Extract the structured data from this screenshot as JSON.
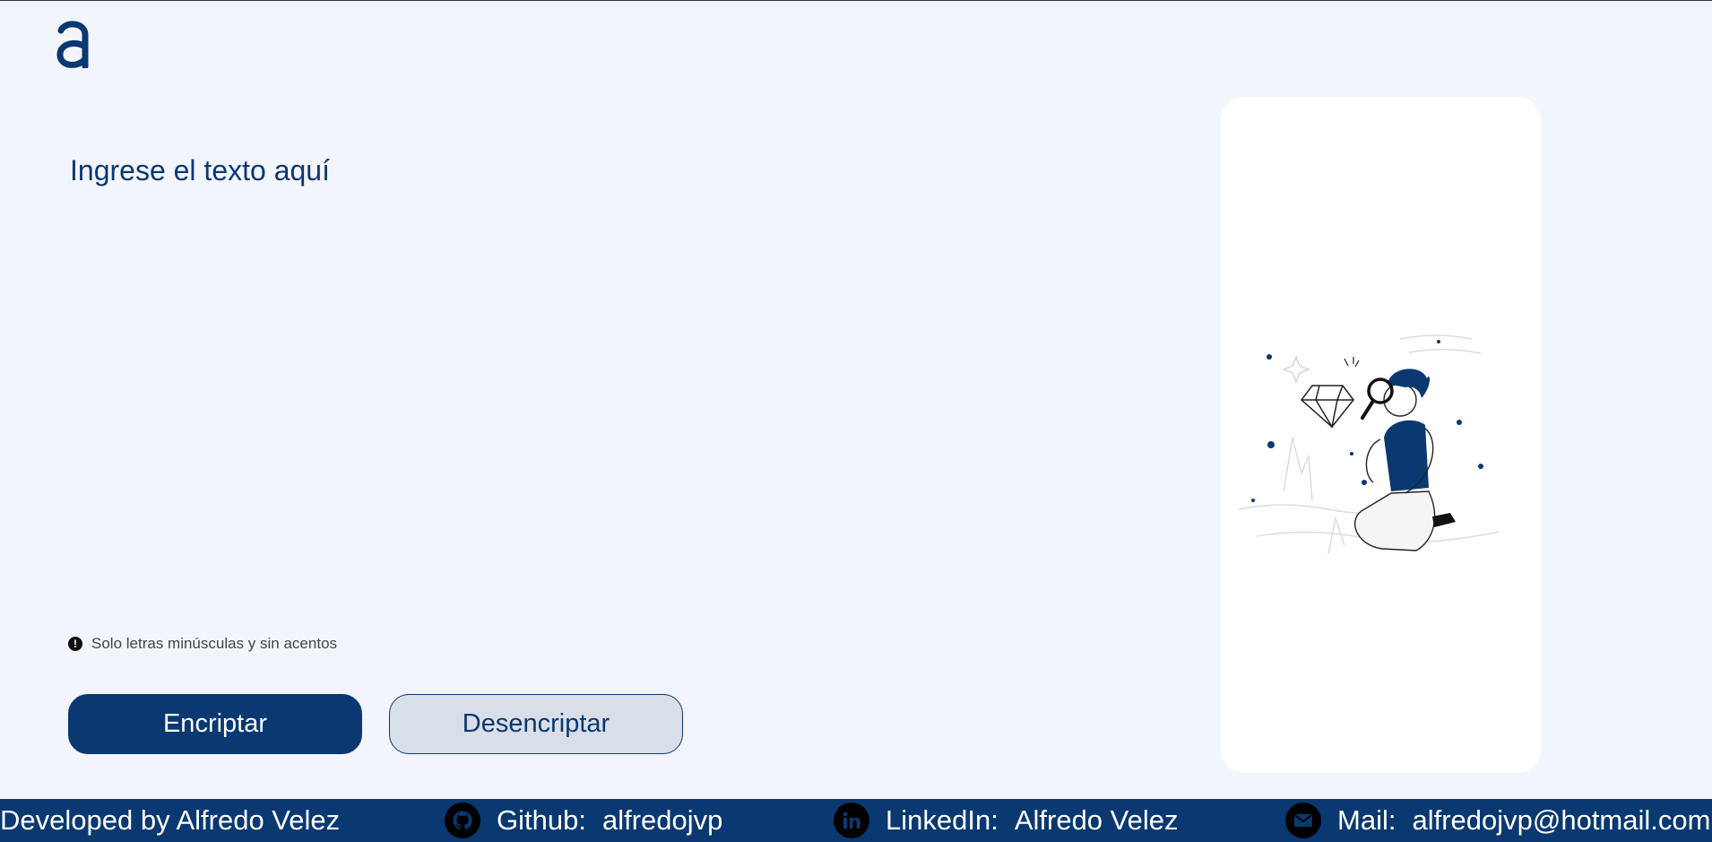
{
  "colors": {
    "accent": "#0a3871",
    "background": "#f3f5fc",
    "card": "#ffffff",
    "secondary_button": "#d8dfe8"
  },
  "logo": {
    "icon": "brand-a-logo"
  },
  "input": {
    "placeholder": "Ingrese el texto aquí",
    "value": ""
  },
  "hint": {
    "icon": "exclamation-circle-icon",
    "text": "Solo letras minúsculas y sin acentos"
  },
  "buttons": {
    "encrypt": "Encriptar",
    "decrypt": "Desencriptar"
  },
  "illustration": {
    "icon": "person-searching-diamond-illustration"
  },
  "footer": {
    "developer": "Developed by Alfredo Velez",
    "github_label": "Github:",
    "github_value": "alfredojvp",
    "linkedin_label": "LinkedIn:",
    "linkedin_value": "Alfredo Velez",
    "mail_label": "Mail:",
    "mail_value": "alfredojvp@hotmail.com"
  }
}
